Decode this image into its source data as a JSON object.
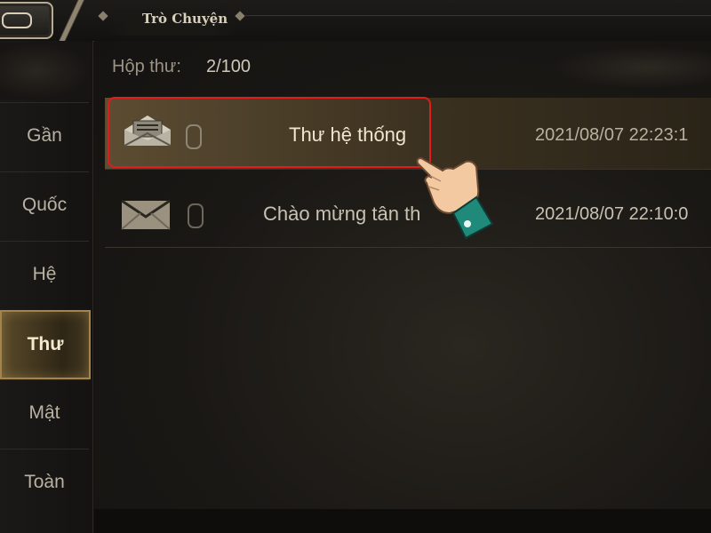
{
  "header": {
    "title": "Trò Chuyện"
  },
  "sidebar": {
    "tabs": [
      {
        "label": "Gần"
      },
      {
        "label": "Quốc"
      },
      {
        "label": "Hệ"
      },
      {
        "label": "Thư",
        "active": true
      },
      {
        "label": "Mật"
      },
      {
        "label": "Toàn"
      }
    ]
  },
  "inbox": {
    "label": "Hộp thư:",
    "count": "2/100"
  },
  "mails": [
    {
      "subject": "Thư hệ thống",
      "date": "2021/08/07 22:23:1",
      "icon": "open-envelope-icon",
      "attachment": true,
      "selected": true
    },
    {
      "subject": "Chào mừng tân th",
      "date": "2021/08/07 22:10:0",
      "icon": "closed-envelope-icon",
      "attachment": true,
      "selected": false
    }
  ],
  "colors": {
    "highlight_border": "#e21b1b",
    "active_tab": "#a4844b",
    "background": "#141210"
  }
}
